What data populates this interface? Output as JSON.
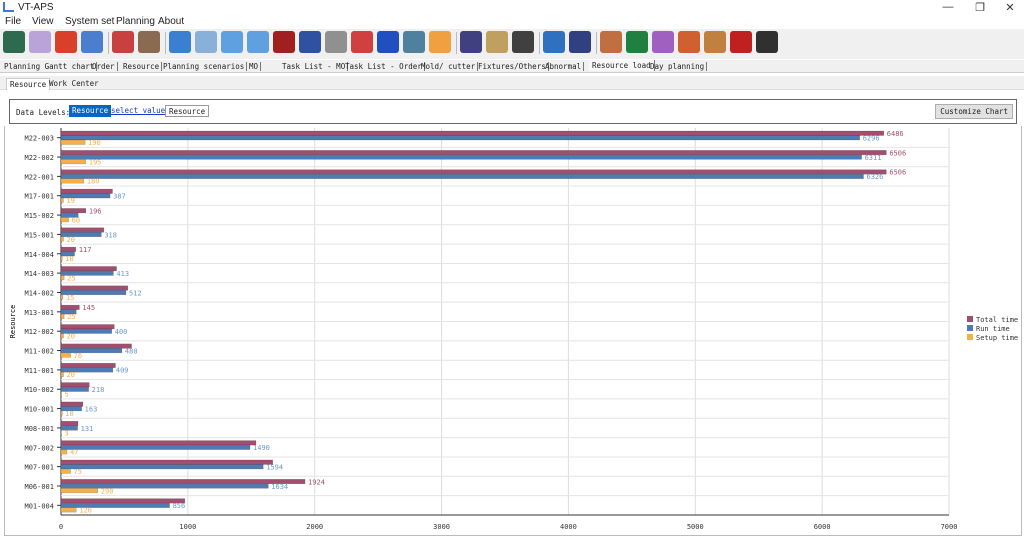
{
  "window": {
    "title": "VT-APS",
    "minimize": "—",
    "maximize": "❐",
    "close": "✕"
  },
  "menu": [
    "File",
    "View",
    "System set",
    "Planning",
    "About"
  ],
  "toolbar_icons": [
    "power-icon",
    "cloud-icon",
    "bar-chart-icon",
    "folder-chart-icon",
    "person-list-icon",
    "gears-icon",
    "gantt-icon",
    "table-chart-icon",
    "zoom-in-icon",
    "zoom-out-icon",
    "calendar-icon",
    "printer-icon",
    "document-icon",
    "grid-icon",
    "tiles-icon",
    "shield-icon",
    "clock-hand-icon",
    "pen-icon",
    "clipboard-icon",
    "save-down-icon",
    "folder-icon",
    "settings-icon",
    "form-icon",
    "excel-icon",
    "tools-icon",
    "timer-icon",
    "form-refresh-icon",
    "database-icon",
    "floppy-icon"
  ],
  "toolbar_colors": [
    "#2d6a4f",
    "#b9a3d9",
    "#d8402a",
    "#4a7fd0",
    "#c94040",
    "#8a6a50",
    "#3b7fd0",
    "#88b0d8",
    "#5ea0e0",
    "#5ea0e0",
    "#a02020",
    "#3050a0",
    "#909090",
    "#d04040",
    "#2050c0",
    "#5080a0",
    "#f0a040",
    "#404080",
    "#c0a060",
    "#404040",
    "#3070c0",
    "#304080",
    "#c07040",
    "#208040",
    "#a060c0",
    "#d06030",
    "#c08040",
    "#c02020",
    "#303030"
  ],
  "tabs": [
    "Planning Gantt chart",
    "Order",
    "Resource",
    "Planning  scenarios",
    "MO",
    "Task List - MO",
    "Task List - Order",
    "Mold/ cutter",
    "Fixtures/Others",
    "Abnormal",
    "Resource load",
    "Day planning"
  ],
  "active_tab": "Resource load",
  "subtabs": [
    "Resource",
    "Work Center"
  ],
  "data_levels": {
    "label": "Data Levels:",
    "chips": [
      "Resource",
      "select value",
      "Resource"
    ],
    "customize": "Customize Chart"
  },
  "chart_data": {
    "type": "bar",
    "orientation": "horizontal",
    "ylabel": "Resource",
    "xlim": [
      0,
      7000
    ],
    "xticks": [
      0,
      1000,
      2000,
      3000,
      4000,
      5000,
      6000,
      7000
    ],
    "grid": true,
    "legend_placement": "right",
    "categories": [
      "M22-003",
      "M22-002",
      "M22-001",
      "M17-001",
      "M15-002",
      "M15-001",
      "M14-004",
      "M14-003",
      "M14-002",
      "M13-001",
      "M12-002",
      "M11-002",
      "M11-001",
      "M10-002",
      "M10-001",
      "M08-001",
      "M07-002",
      "M07-001",
      "M06-001",
      "M01-004"
    ],
    "series": [
      {
        "name": "Total time",
        "color": "#a0506e",
        "values": [
          6486,
          6506,
          6506,
          406,
          196,
          338,
          117,
          438,
          527,
          145,
          420,
          556,
          429,
          223,
          173,
          134,
          1537,
          1669,
          1924,
          976
        ]
      },
      {
        "name": "Run time",
        "color": "#4f7bb3",
        "values": [
          6296,
          6311,
          6326,
          387,
          136,
          318,
          107,
          413,
          512,
          120,
          400,
          480,
          409,
          218,
          163,
          131,
          1490,
          1594,
          1634,
          856
        ]
      },
      {
        "name": "Setup time",
        "color": "#f5b04a",
        "values": [
          190,
          195,
          180,
          19,
          60,
          20,
          10,
          25,
          15,
          25,
          20,
          76,
          20,
          5,
          10,
          3,
          47,
          75,
          290,
          120
        ]
      }
    ],
    "labeled_series": [
      [
        0,
        1,
        2
      ],
      [
        0,
        1,
        2
      ],
      [
        0,
        1,
        2
      ],
      [
        1,
        2
      ],
      [
        0,
        2
      ],
      [
        1,
        2
      ],
      [
        0,
        2
      ],
      [
        1,
        2
      ],
      [
        1,
        2
      ],
      [
        0,
        2
      ],
      [
        1,
        2
      ],
      [
        1,
        2
      ],
      [
        1,
        2
      ],
      [
        1,
        2
      ],
      [
        1,
        2
      ],
      [
        1,
        2
      ],
      [
        1,
        2
      ],
      [
        1,
        2
      ],
      [
        0,
        1,
        2
      ],
      [
        1,
        2
      ]
    ]
  }
}
